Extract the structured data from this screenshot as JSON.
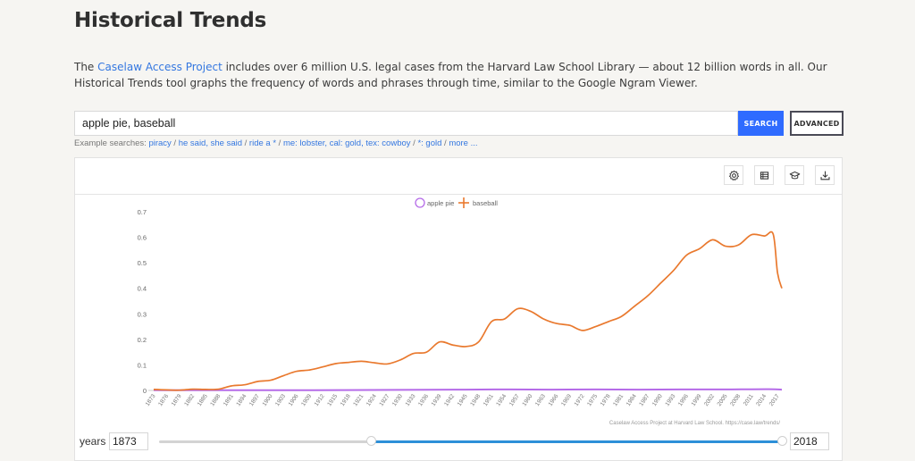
{
  "page": {
    "title": "Historical Trends",
    "intro": {
      "prefix": "The ",
      "link_text": "Caselaw Access Project",
      "suffix": " includes over 6 million U.S. legal cases from the Harvard Law School Library — about 12 billion words in all. Our Historical Trends tool graphs the frequency of words and phrases through time, similar to the Google Ngram Viewer."
    }
  },
  "search": {
    "value": "apple pie, baseball",
    "search_label": "SEARCH",
    "advanced_label": "ADVANCED",
    "examples_label": "Example searches: ",
    "examples": [
      "piracy",
      "he said, she said",
      "ride a *",
      "me: lobster, cal: gold, tex: cowboy",
      "*: gold",
      "more ..."
    ],
    "separator": " / "
  },
  "toolbar": {
    "icons": [
      "gear-icon",
      "table-icon",
      "graduation-cap-icon",
      "download-icon"
    ]
  },
  "years": {
    "label": "years",
    "start": "1873",
    "end": "2018",
    "min": 1873,
    "max": 2018,
    "selected_range_fraction": [
      0.34,
      1.0
    ]
  },
  "colors": {
    "apple_pie": "#b56be8",
    "baseball": "#e9792e",
    "search_button": "#2f6bff",
    "link": "#3477e0",
    "slider_range": "#2d8fd8"
  },
  "chart_data": {
    "type": "line",
    "title": "",
    "xlabel": "",
    "ylabel": "",
    "ylim": [
      0,
      0.7
    ],
    "xlim": [
      1873,
      2018
    ],
    "grid": false,
    "legend": {
      "placement": "top-center",
      "entries": [
        {
          "name": "apple pie",
          "marker": "circle"
        },
        {
          "name": "baseball",
          "marker": "cross"
        }
      ]
    },
    "y_ticks": [
      "0",
      "0.1",
      "0.2",
      "0.3",
      "0.4",
      "0.5",
      "0.6",
      "0.7"
    ],
    "x_ticks": [
      "1873",
      "1876",
      "1879",
      "1882",
      "1885",
      "1888",
      "1891",
      "1894",
      "1897",
      "1900",
      "1903",
      "1906",
      "1909",
      "1912",
      "1915",
      "1918",
      "1921",
      "1924",
      "1927",
      "1930",
      "1933",
      "1936",
      "1939",
      "1942",
      "1945",
      "1948",
      "1951",
      "1954",
      "1957",
      "1960",
      "1963",
      "1966",
      "1969",
      "1972",
      "1975",
      "1978",
      "1981",
      "1984",
      "1987",
      "1990",
      "1993",
      "1996",
      "1999",
      "2002",
      "2005",
      "2008",
      "2011",
      "2014",
      "2017"
    ],
    "annotation": "Caselaw Access Project at Harvard Law School. https://case.law/trends/",
    "series": [
      {
        "name": "apple pie",
        "x": [
          1873,
          1890,
          1910,
          1930,
          1945,
          1955,
          1965,
          1975,
          1985,
          1995,
          2005,
          2015,
          2018
        ],
        "values": [
          0.001,
          0.001,
          0.001,
          0.002,
          0.003,
          0.004,
          0.003,
          0.004,
          0.003,
          0.004,
          0.004,
          0.005,
          0.003
        ]
      },
      {
        "name": "baseball",
        "x": [
          1873,
          1876,
          1879,
          1882,
          1885,
          1888,
          1891,
          1894,
          1897,
          1900,
          1903,
          1906,
          1909,
          1912,
          1915,
          1918,
          1921,
          1924,
          1927,
          1930,
          1933,
          1936,
          1939,
          1942,
          1945,
          1948,
          1951,
          1954,
          1957,
          1960,
          1963,
          1966,
          1969,
          1972,
          1975,
          1978,
          1981,
          1984,
          1987,
          1990,
          1993,
          1996,
          1999,
          2002,
          2005,
          2008,
          2011,
          2014,
          2016,
          2017,
          2018
        ],
        "values": [
          0.004,
          0.002,
          0.001,
          0.005,
          0.004,
          0.005,
          0.018,
          0.022,
          0.035,
          0.04,
          0.058,
          0.075,
          0.08,
          0.092,
          0.105,
          0.11,
          0.114,
          0.108,
          0.104,
          0.12,
          0.145,
          0.15,
          0.19,
          0.178,
          0.172,
          0.19,
          0.27,
          0.28,
          0.32,
          0.31,
          0.28,
          0.262,
          0.255,
          0.235,
          0.25,
          0.27,
          0.29,
          0.33,
          0.37,
          0.42,
          0.47,
          0.53,
          0.555,
          0.59,
          0.565,
          0.57,
          0.61,
          0.605,
          0.612,
          0.46,
          0.4
        ]
      }
    ]
  }
}
